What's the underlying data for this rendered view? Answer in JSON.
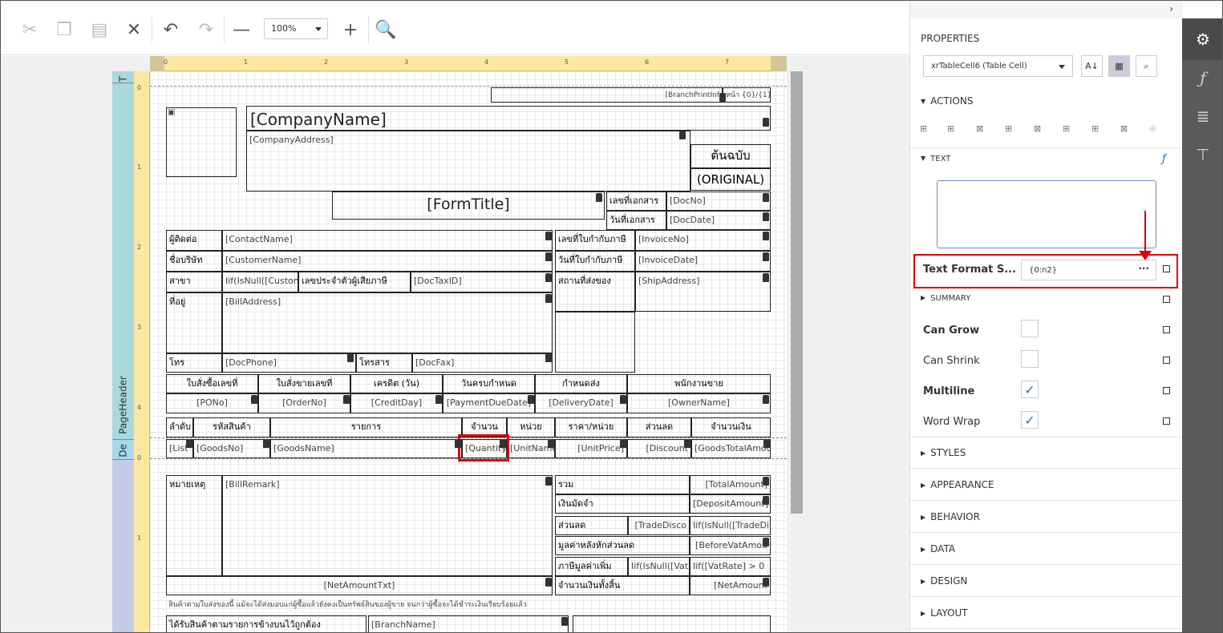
{
  "toolbar": {
    "zoom_value": "100%",
    "buttons": [
      "cut-icon",
      "copy-icon",
      "paste-icon",
      "delete-icon",
      "undo-icon",
      "redo-icon",
      "zoom-out-icon",
      "zoom-in-icon",
      "preview-icon"
    ]
  },
  "ruler": {
    "h_labels": [
      "0",
      "1",
      "2",
      "3",
      "4",
      "5",
      "6",
      "7"
    ],
    "v_labels_top": [
      "0",
      "1",
      "2",
      "3",
      "4"
    ],
    "v_labels_bottom": [
      "0",
      "1"
    ]
  },
  "bands": {
    "top_margin": "T",
    "page_header": "PageHeader",
    "detail": "De"
  },
  "report": {
    "branch_print": "[BranchPrintInf",
    "page_no": "หน้า {0}/{1}",
    "company_name": "[CompanyName]",
    "company_address": "[CompanyAddress]",
    "original_th": "ต้นฉบับ",
    "original_en": "(ORIGINAL)",
    "form_title": "[FormTitle]",
    "doc_no_lbl": "เลขที่เอกสาร",
    "doc_no": "[DocNo]",
    "doc_date_lbl": "วันที่เอกสาร",
    "doc_date": "[DocDate]",
    "contact_lbl": "ผู้ติดต่อ",
    "contact": "[ContactName]",
    "customer_lbl": "ชื่อบริษัท",
    "customer": "[CustomerName]",
    "branch_lbl": "สาขา",
    "branch": "Iif(IsNull([Custon",
    "taxid_lbl": "เลขประจำตัวผู้เสียภาษี",
    "taxid": "[DocTaxID]",
    "address_lbl": "ที่อยู่",
    "address": "[BillAddress]",
    "phone_lbl": "โทร",
    "phone": "[DocPhone]",
    "fax_lbl": "โทรสาร",
    "fax": "[DocFax]",
    "invoice_no_lbl": "เลขที่ใบกำกับภาษี",
    "invoice_no": "[InvoiceNo]",
    "invoice_date_lbl": "วันที่ใบกำกับภาษี",
    "invoice_date": "[InvoiceDate]",
    "ship_lbl": "สถานที่ส่งของ",
    "ship": "[ShipAddress]",
    "order_headers": [
      "ใบสั่งซื้อเลขที่",
      "ใบสั่งขายเลขที่",
      "เครดิต (วัน)",
      "วันครบกำหนด",
      "กำหนดส่ง",
      "พนักงานขาย"
    ],
    "order_values": [
      "[PONo]",
      "[OrderNo]",
      "[CreditDay]",
      "[PaymentDueDate]",
      "[DeliveryDate]",
      "[OwnerName]"
    ],
    "item_headers": [
      "ลำดับ",
      "รหัสสินค้า",
      "รายการ",
      "จำนวน",
      "หน่วย",
      "ราคา/หน่วย",
      "ส่วนลด",
      "จำนวนเงิน"
    ],
    "item_values": [
      "[List",
      "[GoodsNo]",
      "[GoodsName]",
      "[Quantity",
      "[UnitName",
      "[UnitPrice]",
      "[Discount",
      "[GoodsTotalAmou"
    ],
    "remark_lbl": "หมายเหตุ",
    "remark": "[BillRemark]",
    "sum_lbl": "รวม",
    "sum_val": "[TotalAmount]",
    "deposit_lbl": "เงินมัดจำ",
    "deposit_val": "[DepositAmount]",
    "discount_lbl": "ส่วนลด",
    "discount_a": "[TradeDisco",
    "discount_b": "Iif(IsNull([TradeDi",
    "before_vat_lbl": "มูลค่าหลังหักส่วนลด",
    "before_vat_val": "[BeforeVatAmou",
    "vat_lbl": "ภาษีมูลค่าเพิ่ม",
    "vat_a": "Iif(IsNull([Vat",
    "vat_b": "Iif([VatRate] > 0",
    "net_txt": "[NetAmountTxt]",
    "net_lbl": "จำนวนเงินทั้งสิ้น",
    "net_val": "[NetAmount",
    "notice": "สินค้าตามใบส่งของนี้ แม้จะได้ส่งมอบแก่ผู้ซื้อแล้วยังคงเป็นทรัพย์สินของผู้ขาย จนกว่าผู้ซื้อจะได้ชำระเงินเรียบร้อยแล้ว",
    "received_lbl": "ได้รับสินค้าตามรายการข้างบนไว้ถูกต้อง",
    "branch_name": "[BranchName]"
  },
  "panel": {
    "title": "PROPERTIES",
    "selected": "xrTableCell6 (Table Cell)",
    "sections": {
      "actions": "ACTIONS",
      "text": "TEXT",
      "summary": "SUMMARY",
      "styles": "STYLES",
      "appearance": "APPEARANCE",
      "behavior": "BEHAVIOR",
      "data": "DATA",
      "design": "DESIGN",
      "layout": "LAYOUT"
    },
    "text_format_label": "Text Format S...",
    "text_format_value": "{0:n2}",
    "props": [
      {
        "label": "Can Grow",
        "checked": false,
        "bold": true
      },
      {
        "label": "Can Shrink",
        "checked": false,
        "bold": false
      },
      {
        "label": "Multiline",
        "checked": true,
        "bold": true
      },
      {
        "label": "Word Wrap",
        "checked": true,
        "bold": false
      }
    ]
  },
  "colors": {
    "accent": "#2a6fb0",
    "highlight": "#dd0000",
    "ruler": "#fbe7a0",
    "page_header_band": "#a9d9dd",
    "detail_band": "#a8d8ec",
    "footer_band": "#c5cbe6"
  }
}
